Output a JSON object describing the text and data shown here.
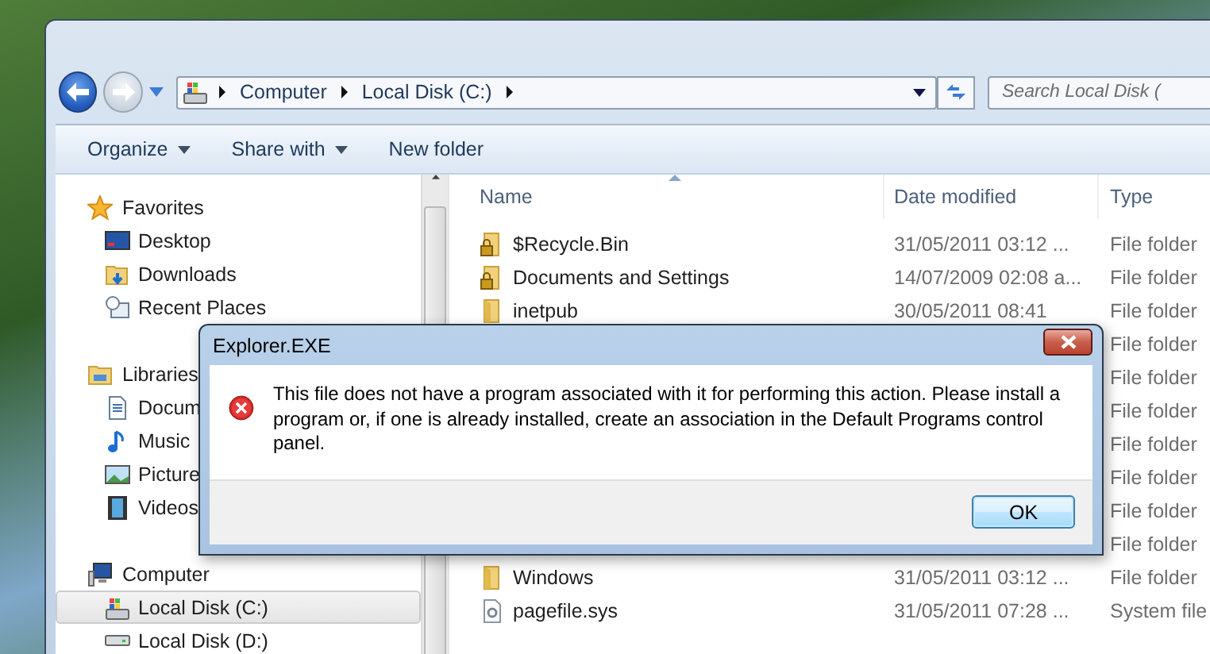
{
  "window": {
    "address": {
      "crumbs": [
        "Computer",
        "Local Disk (C:)"
      ]
    },
    "search": {
      "placeholder": "Search Local Disk ("
    }
  },
  "toolbar": [
    {
      "label": "Organize",
      "dropdown": true
    },
    {
      "label": "Share with",
      "dropdown": true
    },
    {
      "label": "New folder",
      "dropdown": false
    }
  ],
  "navigation": [
    {
      "label": "Favorites",
      "kind": "favorites",
      "items": [
        {
          "label": "Desktop",
          "kind": "desktop",
          "selected": false
        },
        {
          "label": "Downloads",
          "kind": "downloads",
          "selected": false
        },
        {
          "label": "Recent Places",
          "kind": "recent",
          "selected": false
        }
      ]
    },
    {
      "label": "Libraries",
      "kind": "libraries",
      "items": [
        {
          "label": "Docum",
          "kind": "documents",
          "selected": false
        },
        {
          "label": "Music",
          "kind": "music",
          "selected": false
        },
        {
          "label": "Picture",
          "kind": "pictures",
          "selected": false
        },
        {
          "label": "Videos",
          "kind": "videos",
          "selected": false
        }
      ]
    },
    {
      "label": "Computer",
      "kind": "computer",
      "items": [
        {
          "label": "Local Disk (C:)",
          "kind": "system-drive",
          "selected": true
        },
        {
          "label": "Local Disk (D:)",
          "kind": "drive",
          "selected": false
        }
      ]
    }
  ],
  "file_list": {
    "columns": [
      {
        "label": "Name",
        "sorted": true
      },
      {
        "label": "Date modified",
        "sorted": false
      },
      {
        "label": "Type",
        "sorted": false
      }
    ],
    "rows": [
      {
        "kind": "locked-folder",
        "name": "$Recycle.Bin",
        "date": "31/05/2011 03:12 ...",
        "type": "File folder"
      },
      {
        "kind": "locked-folder",
        "name": "Documents and Settings",
        "date": "14/07/2009 02:08 a...",
        "type": "File folder"
      },
      {
        "kind": "folder",
        "name": "inetpub",
        "date": "30/05/2011 08:41",
        "type": "File folder"
      },
      {
        "type": "File folder"
      },
      {
        "type": "File folder"
      },
      {
        "type": "File folder"
      },
      {
        "type": "File folder"
      },
      {
        "type": "File folder"
      },
      {
        "type": "File folder"
      },
      {
        "type": "File folder"
      },
      {
        "kind": "folder",
        "name": "Windows",
        "date": "31/05/2011 03:12 ...",
        "type": "File folder"
      },
      {
        "kind": "system-file",
        "name": "pagefile.sys",
        "date": "31/05/2011 07:28 ...",
        "type": "System file"
      }
    ]
  },
  "dialog": {
    "title": "Explorer.EXE",
    "message": "This file does not have a program associated with it for performing this action. Please install a program or, if one is already installed, create an association in the Default Programs control panel.",
    "buttons": [
      "OK"
    ]
  }
}
